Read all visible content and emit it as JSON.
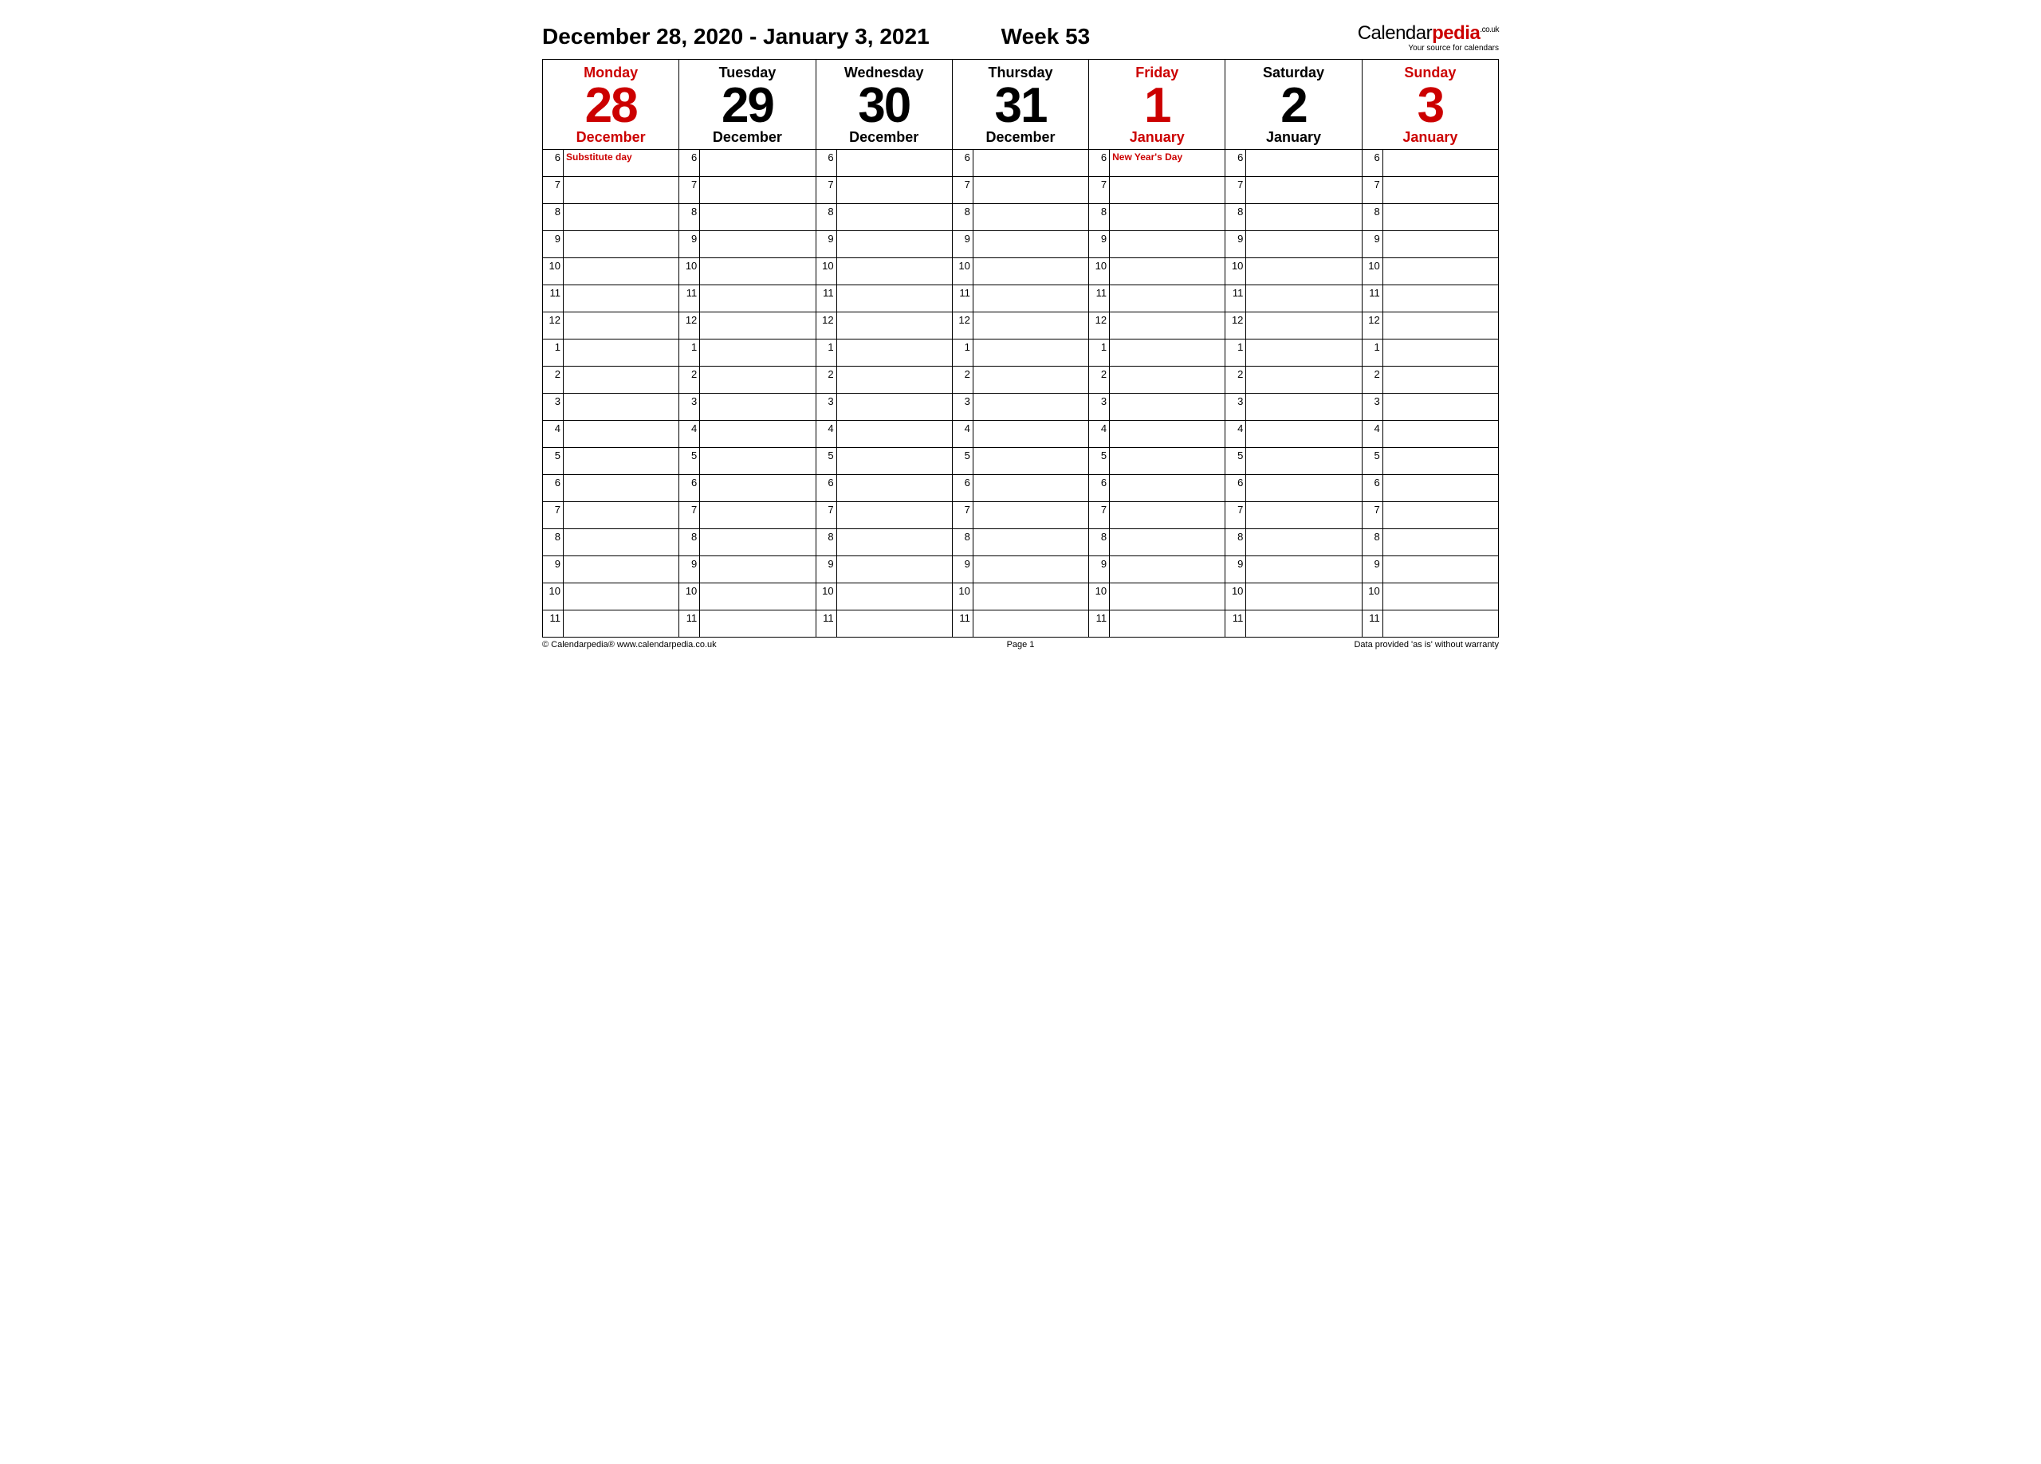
{
  "header": {
    "date_range": "December 28, 2020 - January 3, 2021",
    "week_label": "Week 53",
    "brand_a": "Calendar",
    "brand_b": "pedia",
    "brand_suffix": ".co.uk",
    "brand_tag": "Your source for calendars"
  },
  "hours": [
    6,
    7,
    8,
    9,
    10,
    11,
    12,
    1,
    2,
    3,
    4,
    5,
    6,
    7,
    8,
    9,
    10,
    11
  ],
  "days": [
    {
      "name": "Monday",
      "num": "28",
      "month": "December",
      "highlight": true,
      "events": {
        "0": "Substitute day"
      }
    },
    {
      "name": "Tuesday",
      "num": "29",
      "month": "December",
      "highlight": false,
      "events": {}
    },
    {
      "name": "Wednesday",
      "num": "30",
      "month": "December",
      "highlight": false,
      "events": {}
    },
    {
      "name": "Thursday",
      "num": "31",
      "month": "December",
      "highlight": false,
      "events": {}
    },
    {
      "name": "Friday",
      "num": "1",
      "month": "January",
      "highlight": true,
      "events": {
        "0": "New Year's Day"
      }
    },
    {
      "name": "Saturday",
      "num": "2",
      "month": "January",
      "highlight": false,
      "events": {}
    },
    {
      "name": "Sunday",
      "num": "3",
      "month": "January",
      "highlight": true,
      "events": {}
    }
  ],
  "footer": {
    "left": "© Calendarpedia®   www.calendarpedia.co.uk",
    "center": "Page 1",
    "right": "Data provided 'as is' without warranty"
  }
}
